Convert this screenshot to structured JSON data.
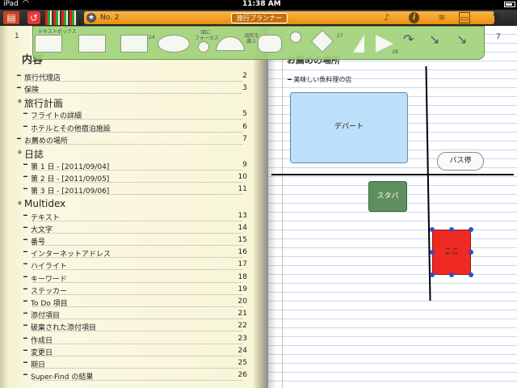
{
  "status_bar": {
    "carrier": "iPad",
    "time": "11:38 AM"
  },
  "toolbar": {
    "note_number": "No. 2",
    "title": "旅行プランナー",
    "icons": [
      "book-icon",
      "undo-icon",
      "star-icon",
      "mic-icon",
      "info-icon",
      "wifi-icon",
      "image-icon",
      "pencil-icon"
    ]
  },
  "palette": {
    "textbox_label": "テキストボックス",
    "focus_label_1": "図に",
    "focus_label_2": "フォーカス",
    "shape_label_1": "図形を",
    "shape_label_2": "選ぶ",
    "sizes": [
      "24",
      "27",
      "18"
    ]
  },
  "left_page": {
    "page_number": "1",
    "toc_title": "内容",
    "entries": [
      {
        "text": "旅行代理店",
        "page": "2",
        "kind": "item",
        "indent": 0
      },
      {
        "text": "保険",
        "page": "3",
        "kind": "item",
        "indent": 0
      },
      {
        "text": "旅行計画",
        "page": "",
        "kind": "section",
        "indent": 0
      },
      {
        "text": "フライトの詳細",
        "page": "5",
        "kind": "item",
        "indent": 1
      },
      {
        "text": "ホテルとその他宿泊施設",
        "page": "6",
        "kind": "item",
        "indent": 1
      },
      {
        "text": "お薦めの場所",
        "page": "7",
        "kind": "item",
        "indent": 0
      },
      {
        "text": "日誌",
        "page": "",
        "kind": "section",
        "indent": 0
      },
      {
        "text": "第 1 日 - [2011/09/04]",
        "page": "9",
        "kind": "item",
        "indent": 1
      },
      {
        "text": "第 2 日 - [2011/09/05]",
        "page": "10",
        "kind": "item",
        "indent": 1
      },
      {
        "text": "第 3 日 - [2011/09/06]",
        "page": "11",
        "kind": "item",
        "indent": 1
      },
      {
        "text": "Multidex",
        "page": "",
        "kind": "section",
        "indent": 0
      },
      {
        "text": "テキスト",
        "page": "13",
        "kind": "item",
        "indent": 1
      },
      {
        "text": "大文字",
        "page": "14",
        "kind": "item",
        "indent": 1
      },
      {
        "text": "番号",
        "page": "15",
        "kind": "item",
        "indent": 1
      },
      {
        "text": "インターネットアドレス",
        "page": "16",
        "kind": "item",
        "indent": 1
      },
      {
        "text": "ハイライト",
        "page": "17",
        "kind": "item",
        "indent": 1
      },
      {
        "text": "キーワード",
        "page": "18",
        "kind": "item",
        "indent": 1
      },
      {
        "text": "ステッカー",
        "page": "19",
        "kind": "item",
        "indent": 1
      },
      {
        "text": "To Do 項目",
        "page": "20",
        "kind": "item",
        "indent": 1
      },
      {
        "text": "添付項目",
        "page": "21",
        "kind": "item",
        "indent": 1
      },
      {
        "text": "破棄された添付項目",
        "page": "22",
        "kind": "item",
        "indent": 1
      },
      {
        "text": "作成日",
        "page": "23",
        "kind": "item",
        "indent": 1
      },
      {
        "text": "変更日",
        "page": "24",
        "kind": "item",
        "indent": 1
      },
      {
        "text": "期日",
        "page": "25",
        "kind": "item",
        "indent": 1
      },
      {
        "text": "Super-Find の結果",
        "page": "26",
        "kind": "item",
        "indent": 1
      }
    ]
  },
  "right_page": {
    "page_number": "7",
    "title": "お薦めの場所",
    "bullet": "美味しい魚料理の店",
    "shapes": {
      "department": "デパート",
      "bus_stop": "バス停",
      "starbucks": "スタバ",
      "here": "ここ"
    }
  },
  "colors": {
    "toolbar_orange": "#f0a030",
    "palette_green": "#a0d278",
    "department_blue": "#bde0fa",
    "starbucks_green": "#5f8f60",
    "here_red": "#ee2a22",
    "selection_handle": "#2f4fd0"
  }
}
